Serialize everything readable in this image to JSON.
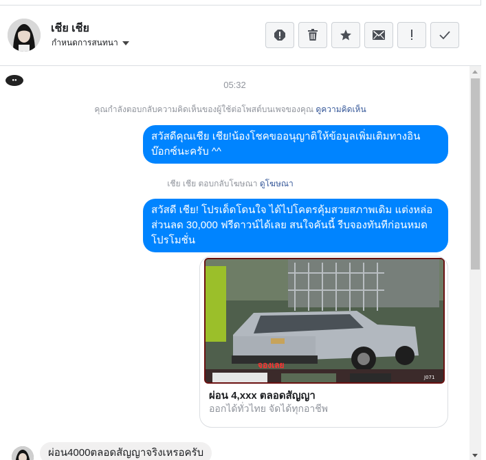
{
  "header": {
    "name": "เชีย เชีย",
    "assign_label": "กำหนดการสนทนา",
    "actions": [
      "spam-icon",
      "trash-icon",
      "star-icon",
      "envelope-icon",
      "alert-icon",
      "check-icon"
    ]
  },
  "chat": {
    "time": "05:32",
    "system_comment": "คุณกำลังตอบกลับความคิดเห็นของผู้ใช้ต่อโพสต์บนเพจของคุณ",
    "system_comment_link": "ดูความคิดเห็น",
    "bubble1": "สวัสดีคุณเชีย เชีย!น้องโชคขออนุญาติให้ข้อมูลเพิ่มเติมทางอินบ๊อกซ์นะครับ ^^",
    "system_ad": "เชีย เชีย ตอบกลับโฆษณา",
    "system_ad_link": "ดูโฆษณา",
    "bubble2": "สวัสดี เชีย! โปรเด็ดโดนใจ ได้ไปโคตรคุ้มสวยสภาพเดิม แต่งหล่อ ส่วนลด 30,000 ฟรีดาวน์ได้เลย  สนใจคันนี้ รีบจองทันทีก่อนหมดโปรโมชั่น",
    "card": {
      "badge": "จองเลย",
      "plate": "J071",
      "title": "ผ่อน 4,xxx ตลอดสัญญา",
      "subtitle": "ออกได้ทั่วไทย จัดได้ทุกอาชีพ"
    },
    "incoming": "ผ่อน4000ตลอดสัญญาจริงเหรอครับ"
  },
  "colors": {
    "sent_bubble": "#0084ff",
    "link": "#365899",
    "meta": "#90949c"
  }
}
